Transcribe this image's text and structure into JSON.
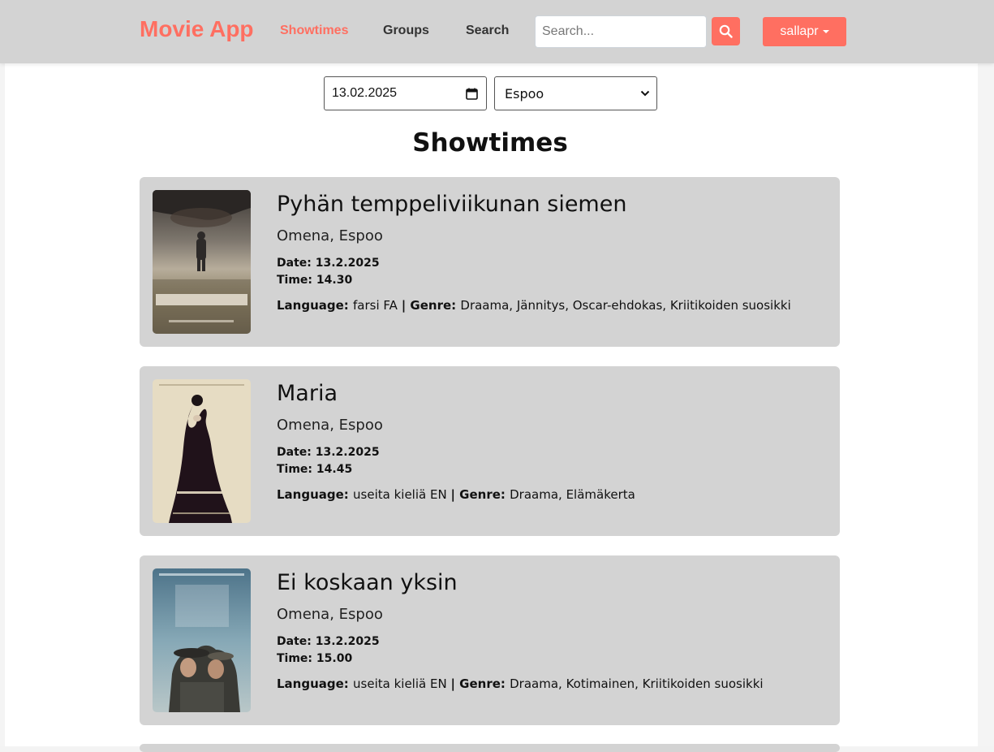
{
  "navbar": {
    "brand": "Movie App",
    "links": [
      "Showtimes",
      "Groups",
      "Search"
    ],
    "active_link": "Showtimes",
    "search_placeholder": "Search...",
    "search_value": "",
    "search_icon": "search-icon",
    "user_label": "sallapr",
    "accent_color": "#ff6f61",
    "bar_color": "#d3d3d3"
  },
  "filters": {
    "date_value": "13.02.2025",
    "calendar_icon": "calendar-icon",
    "theatre_selected": "Espoo"
  },
  "page": {
    "title": "Showtimes"
  },
  "labels": {
    "language": "Language:",
    "separator": " | ",
    "genre": "Genre:"
  },
  "showtimes": [
    {
      "title": "Pyhän temppeliviikunan siemen",
      "theatre": "Omena, Espoo",
      "date": "Date: 13.2.2025",
      "time": "Time: 14.30",
      "language": "farsi FA",
      "genre": "Draama, Jännitys, Oscar-ehdokas, Kriitikoiden suosikki"
    },
    {
      "title": "Maria",
      "theatre": "Omena, Espoo",
      "date": "Date: 13.2.2025",
      "time": "Time: 14.45",
      "language": "useita kieliä EN",
      "genre": "Draama, Elämäkerta"
    },
    {
      "title": "Ei koskaan yksin",
      "theatre": "Omena, Espoo",
      "date": "Date: 13.2.2025",
      "time": "Time: 15.00",
      "language": "useita kieliä EN",
      "genre": "Draama, Kotimainen, Kriitikoiden suosikki"
    }
  ]
}
